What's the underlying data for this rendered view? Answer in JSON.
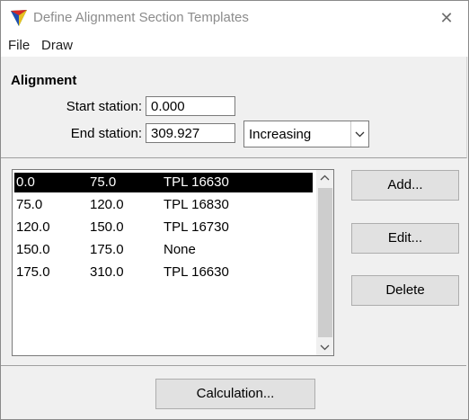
{
  "window": {
    "title": "Define Alignment Section Templates"
  },
  "menu": {
    "items": [
      "File",
      "Draw"
    ]
  },
  "alignment": {
    "group_title": "Alignment",
    "start_label": "Start station:",
    "start_value": "0.000",
    "end_label": "End station:",
    "end_value": "309.927",
    "direction_selected": "Increasing"
  },
  "sections": {
    "rows": [
      {
        "start": "0.0",
        "end": "75.0",
        "template": "TPL 16630",
        "selected": true
      },
      {
        "start": "75.0",
        "end": "120.0",
        "template": "TPL 16830",
        "selected": false
      },
      {
        "start": "120.0",
        "end": "150.0",
        "template": "TPL 16730",
        "selected": false
      },
      {
        "start": "150.0",
        "end": "175.0",
        "template": "None",
        "selected": false
      },
      {
        "start": "175.0",
        "end": "310.0",
        "template": "TPL 16630",
        "selected": false
      }
    ]
  },
  "buttons": {
    "add": "Add...",
    "edit": "Edit...",
    "delete": "Delete",
    "calculation": "Calculation..."
  },
  "colors": {
    "selection": "#000000",
    "window_bg": "#f0f0f0",
    "title_text": "#8c8c8c"
  }
}
